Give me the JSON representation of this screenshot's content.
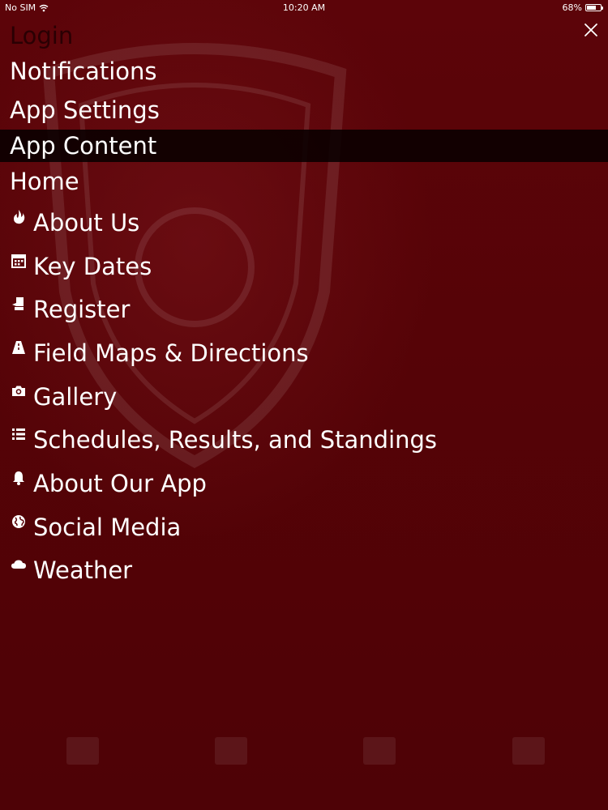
{
  "status_bar": {
    "carrier": "No SIM",
    "time": "10:20 AM",
    "battery_text": "68%",
    "battery_level": 0.68
  },
  "menu": {
    "items": [
      {
        "label": "Login"
      },
      {
        "label": "Notifications"
      },
      {
        "label": "App Settings"
      },
      {
        "label": "App Content",
        "active": true
      },
      {
        "label": "Home"
      },
      {
        "label": "About Us",
        "icon": "fire-icon"
      },
      {
        "label": "Key Dates",
        "icon": "calendar-icon"
      },
      {
        "label": "Register",
        "icon": "register-icon"
      },
      {
        "label": "Field Maps & Directions",
        "icon": "road-icon"
      },
      {
        "label": "Gallery",
        "icon": "camera-icon"
      },
      {
        "label": "Schedules, Results, and Standings",
        "icon": "list-icon"
      },
      {
        "label": "About Our App",
        "icon": "bell-icon"
      },
      {
        "label": "Social Media",
        "icon": "globe-icon"
      },
      {
        "label": "Weather",
        "icon": "cloud-icon"
      }
    ]
  },
  "colors": {
    "background": "#5a0408",
    "active_row": "#080000",
    "text": "#ffffff"
  }
}
